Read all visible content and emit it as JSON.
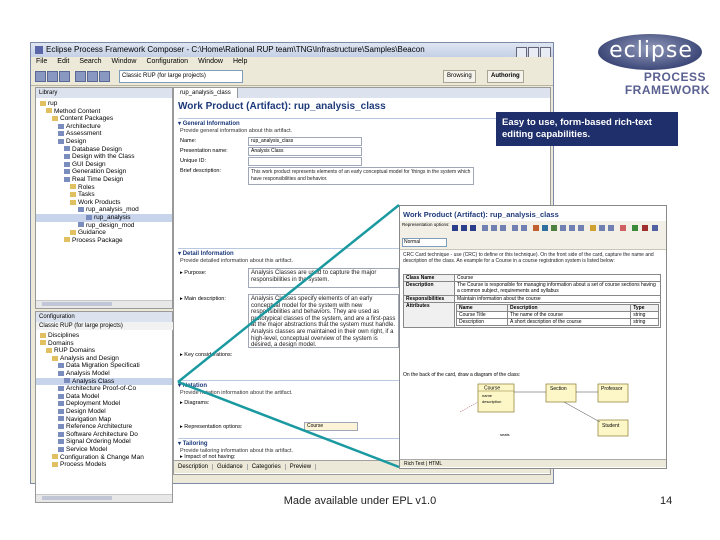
{
  "logo": {
    "word": "eclipse",
    "line1": "PROCESS",
    "line2": "FRAMEWORK"
  },
  "window": {
    "title": "Eclipse Process Framework Composer - C:\\Home\\Rational RUP team\\TNG\\Infrastructure\\Samples\\Beacon",
    "menu": [
      "File",
      "Edit",
      "Search",
      "Window",
      "Configuration",
      "Window",
      "Help"
    ],
    "config_combo": "Classic RUP (for large projects)",
    "perspectives": [
      "Browsing",
      "Authoring"
    ]
  },
  "library_panel": {
    "tab": "Library",
    "items": [
      "rup",
      "Method Content",
      "Content Packages",
      "Architecture",
      "Assessment",
      "Design",
      "Database Design",
      "Design with the Class",
      "GUI Design",
      "Generation Design",
      "Real Time Design",
      "Roles",
      "Tasks",
      "Work Products",
      "rup_analysis_mod",
      "rup_analysis",
      "rup_design_mod",
      "Guidance",
      "Process Package"
    ]
  },
  "config_panel": {
    "tab": "Configuration",
    "subtitle": "Classic RUP (for large projects)",
    "items": [
      "Disciplines",
      "Domains",
      "RUP Domains",
      "Analysis and Design",
      "Data Migration Specificati",
      "Analysis Model",
      "Analysis Class",
      "Architecture Proof-of-Co",
      "Data Model",
      "Deployment Model",
      "Design Model",
      "Navigation Map",
      "Reference Architecture",
      "Software Architecture Do",
      "Signal Ordering Model",
      "Service Model",
      "Configuration & Change Man",
      "Process Models"
    ]
  },
  "editor": {
    "tab": "rup_analysis_class",
    "title": "Work Product (Artifact): rup_analysis_class",
    "general": {
      "heading": "General Information",
      "desc": "Provide general information about this artifact.",
      "fields": [
        {
          "label": "Name:",
          "value": "rup_analysis_class"
        },
        {
          "label": "Presentation name:",
          "value": "Analysis Class"
        },
        {
          "label": "Unique ID:",
          "value": ""
        },
        {
          "label": "Brief description:",
          "value": "This work product represents elements of an early conceptual model for 'things in the system which have responsibilities and behavior."
        }
      ]
    },
    "detail": {
      "heading": "Detail Information",
      "desc": "Provide detailed information about this artifact.",
      "purpose_label": "Purpose:",
      "purpose_text": "Analysis Classes are used to capture the major responsibilities in the system.",
      "main_label": "Main description:",
      "main_text": "Analysis Classes specify elements of an early conceptual model for the system with new responsibilities and behaviors. They are used as prototypical classes of the system, and are a first-pass at the major abstractions that the system must handle. Analysis classes are maintained in their own right, if a high-level, conceptual overview of the system is desired, a design model.",
      "key_label": "Key considerations:"
    },
    "notation": {
      "heading": "Notation",
      "desc": "Provide notation information about the artifact.",
      "items": [
        "Diagrams:",
        "Representation options:"
      ],
      "combo": "Course"
    },
    "tailoring": {
      "heading": "Tailoring",
      "desc": "Provide tailoring information about this artifact.",
      "items": [
        "Impact of not having:"
      ]
    },
    "bottom_tabs": [
      "Description",
      "Guidance",
      "Categories",
      "Preview"
    ]
  },
  "callout": {
    "text": "Easy to use, form-based rich-text editing capabilities."
  },
  "inset": {
    "title": "Work Product (Artifact): rup_analysis_class",
    "toolbar_label": "Representation options:",
    "style_select": "Normal",
    "para": "CRC Card technique - use (CRC) to define or this technique). On the front side of the card, capture the name and description of the class. An example for a Course in a course registration system is listed below:",
    "table1": [
      [
        "Class Name",
        "Course"
      ],
      [
        "Description",
        "The Course is responsible for managing information about a set of course sections having a common subject, requirements and syllabus"
      ],
      [
        "Responsibilities",
        "Maintain information about the course"
      ]
    ],
    "attr_label": "Attributes",
    "attr_headers": [
      "Name",
      "Description",
      "Type"
    ],
    "attr_rows": [
      [
        "Course Title",
        "The name of the course",
        "string"
      ],
      [
        "Description",
        "A short description of the course",
        "string"
      ]
    ],
    "para2": "On the back of the card, draw a diagram of the class:",
    "diagram_labels": [
      "Course",
      "name",
      "description",
      "Section",
      "Professor",
      "Student",
      "seats"
    ],
    "tabs": [
      "Rich Text",
      "HTML"
    ]
  },
  "footer": {
    "text": "Made available under EPL v1.0",
    "page": "14"
  },
  "colors": {
    "callout_bg": "#1f2f6b",
    "title_blue": "#1e3a7a",
    "arrow": "#1a9aa0"
  }
}
